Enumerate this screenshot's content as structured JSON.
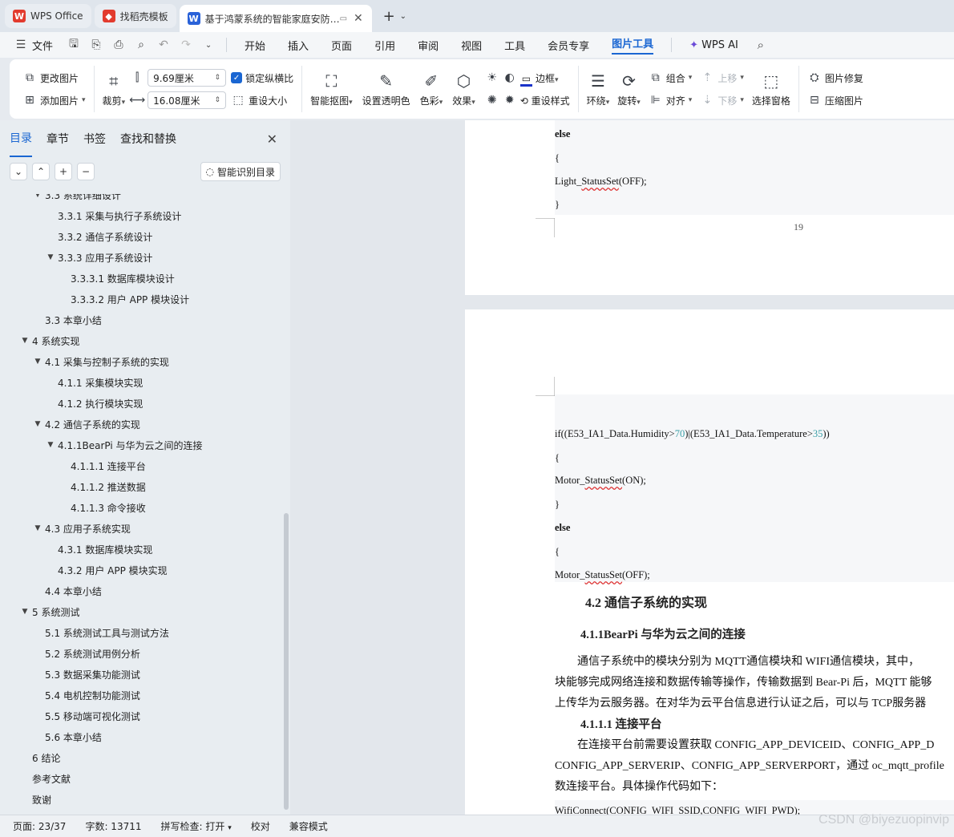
{
  "tabs": [
    {
      "label": "WPS Office",
      "icon": "wps-logo-icon",
      "color": "#e23b2e"
    },
    {
      "label": "找稻壳模板",
      "icon": "docer-icon",
      "color": "#e23b2e"
    },
    {
      "label": "基于鸿蒙系统的智能家庭安防…",
      "icon": "word-doc-icon",
      "color": "#2a62d8"
    }
  ],
  "menubar": {
    "file_label": "文件",
    "items": [
      "开始",
      "插入",
      "页面",
      "引用",
      "审阅",
      "视图",
      "工具",
      "会员专享",
      "图片工具"
    ],
    "active": "图片工具",
    "ai_label": "WPS AI"
  },
  "ribbon": {
    "change_pic": "更改图片",
    "add_pic": "添加图片",
    "crop": "裁剪",
    "height_value": "9.69厘米",
    "width_value": "16.08厘米",
    "lock_ratio": "锁定纵横比",
    "reset_size": "重设大小",
    "smart_cutout": "智能抠图",
    "set_transparent": "设置透明色",
    "color": "色彩",
    "effects": "效果",
    "border": "边框",
    "reset_style": "重设样式",
    "wrap": "环绕",
    "rotate": "旋转",
    "group": "组合",
    "align": "对齐",
    "move_up": "上移",
    "move_down": "下移",
    "selection_pane": "选择窗格",
    "pic_repair": "图片修复",
    "compress": "压缩图片"
  },
  "nav": {
    "tabs": [
      "目录",
      "章节",
      "书签",
      "查找和替换"
    ],
    "ai_toc": "智能识别目录",
    "items": [
      {
        "text": "3.3 系统详细设计",
        "level": 2,
        "expanded": true
      },
      {
        "text": "3.3.1 采集与执行子系统设计",
        "level": 3
      },
      {
        "text": "3.3.2 通信子系统设计",
        "level": 3
      },
      {
        "text": "3.3.3 应用子系统设计",
        "level": 3,
        "expanded": true
      },
      {
        "text": "3.3.3.1 数据库模块设计",
        "level": 4
      },
      {
        "text": "3.3.3.2 用户 APP 模块设计",
        "level": 4
      },
      {
        "text": "3.3 本章小结",
        "level": 2
      },
      {
        "text": "4 系统实现",
        "level": 1,
        "expanded": true
      },
      {
        "text": "4.1 采集与控制子系统的实现",
        "level": 2,
        "expanded": true
      },
      {
        "text": "4.1.1 采集模块实现",
        "level": 3
      },
      {
        "text": "4.1.2 执行模块实现",
        "level": 3
      },
      {
        "text": "4.2 通信子系统的实现",
        "level": 2,
        "expanded": true
      },
      {
        "text": "4.1.1BearPi 与华为云之间的连接",
        "level": 3,
        "expanded": true
      },
      {
        "text": "4.1.1.1 连接平台",
        "level": 4
      },
      {
        "text": "4.1.1.2 推送数据",
        "level": 4
      },
      {
        "text": "4.1.1.3 命令接收",
        "level": 4
      },
      {
        "text": "4.3 应用子系统实现",
        "level": 2,
        "expanded": true
      },
      {
        "text": "4.3.1 数据库模块实现",
        "level": 3
      },
      {
        "text": "4.3.2 用户 APP 模块实现",
        "level": 3
      },
      {
        "text": "4.4 本章小结",
        "level": 2
      },
      {
        "text": "5 系统测试",
        "level": 1,
        "expanded": true
      },
      {
        "text": "5.1 系统测试工具与测试方法",
        "level": 2
      },
      {
        "text": "5.2 系统测试用例分析",
        "level": 2
      },
      {
        "text": "5.3 数据采集功能测试",
        "level": 2
      },
      {
        "text": "5.4 电机控制功能测试",
        "level": 2
      },
      {
        "text": "5.5 移动端可视化测试",
        "level": 2
      },
      {
        "text": "5.6 本章小结",
        "level": 2
      },
      {
        "text": "6 结论",
        "level": 1
      },
      {
        "text": "参考文献",
        "level": 1
      },
      {
        "text": "致谢",
        "level": 1
      }
    ]
  },
  "doc": {
    "page1": {
      "lines": [
        "else",
        "{",
        "Light_StatusSet(OFF);",
        "}"
      ],
      "page_number": "19"
    },
    "page2": {
      "if_parts": [
        "if((E53_IA1_Data.Humidity>",
        "70",
        ")|(E53_IA1_Data.Temperature>",
        "35",
        "))"
      ],
      "lines": [
        "{",
        "Motor_StatusSet(ON);",
        "}",
        "else",
        "{",
        "Motor_StatusSet(OFF);"
      ],
      "h2": "4.2 通信子系统的实现",
      "h3": "4.1.1BearPi 与华为云之间的连接",
      "para1": [
        "通信子系统中的模块分别为 MQTT通信模块和 WIFI通信模块，其中，",
        "块能够完成网络连接和数据传输等操作，传输数据到 Bear-Pi 后，MQTT 能够",
        "上传华为云服务器。在对华为云平台信息进行认证之后，可以与 TCP服务器"
      ],
      "h4": "4.1.1.1 连接平台",
      "para2": [
        "在连接平台前需要设置获取 CONFIG_APP_DEVICEID、CONFIG_APP_D",
        "CONFIG_APP_SERVERIP、CONFIG_APP_SERVERPORT，通过 oc_mqtt_profile",
        "数连接平台。具体操作代码如下："
      ],
      "code_last": "WifiConnect(CONFIG_WIFI_SSID,CONFIG_WIFI_PWD);"
    }
  },
  "status": {
    "page": "页面: 23/37",
    "words": "字数: 13711",
    "spell": "拼写检查: 打开",
    "proof": "校对",
    "compat": "兼容模式"
  },
  "watermark": "CSDN @biyezuopinvip"
}
